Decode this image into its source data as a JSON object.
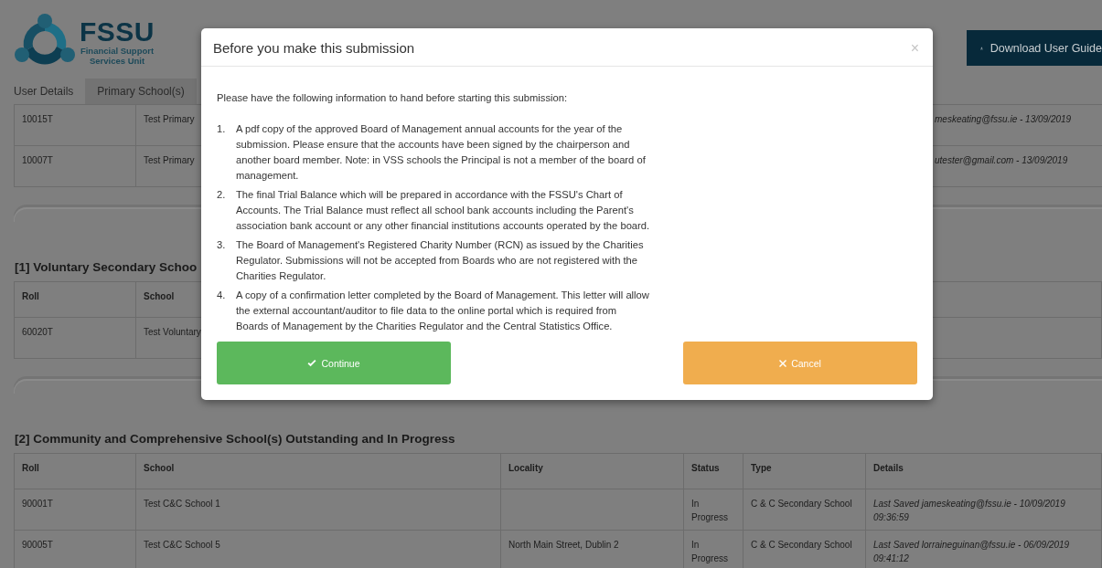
{
  "logo": {
    "name": "FSSU",
    "subtitle_lines": [
      "Financial Support",
      "Services Unit"
    ]
  },
  "download_button": {
    "label": "Download User Guide"
  },
  "tabs": [
    {
      "label": "User Details",
      "selected": false
    },
    {
      "label": "Primary School(s)",
      "selected": true
    }
  ],
  "primary_rows": [
    {
      "roll": "10015T",
      "school": "Test Primary",
      "details": "meskeating@fssu.ie - 13/09/2019"
    },
    {
      "roll": "10007T",
      "school": "Test Primary",
      "details": "utester@gmail.com - 13/09/2019"
    }
  ],
  "sections": [
    {
      "title": "[1] Voluntary Secondary Schoo",
      "columns": [
        "Roll",
        "School"
      ],
      "rows": [
        [
          "60020T",
          "Test Voluntary"
        ]
      ]
    },
    {
      "title": "[2] Community and Comprehensive School(s) Outstanding and In Progress",
      "columns": [
        "Roll",
        "School",
        "Locality",
        "Status",
        "Type",
        "Details"
      ],
      "rows": [
        [
          "90001T",
          "Test C&C School 1",
          "",
          "In Progress",
          "C & C Secondary School",
          "Last Saved jameskeating@fssu.ie - 10/09/2019 09:36:59"
        ],
        [
          "90005T",
          "Test C&C School 5",
          "North Main Street, Dublin 2",
          "In Progress",
          "C & C Secondary School",
          "Last Saved lorraineguinan@fssu.ie - 06/09/2019 09:41:12"
        ]
      ]
    }
  ],
  "modal": {
    "title": "Before you make this submission",
    "close": "×",
    "intro": "Please have the following information to hand before starting this submission:",
    "items": [
      {
        "number": "1.",
        "text": "A pdf copy of the approved Board of Management annual accounts for the year of the submission. Please ensure that the accounts have been signed by the chairperson and another board member. Note: in VSS schools the Principal is not a member of the board of management."
      },
      {
        "number": "2.",
        "text": "The final Trial Balance which will be prepared in accordance with the FSSU's Chart of Accounts. The Trial Balance must reflect all school bank accounts including the Parent's association bank account or any other financial institutions accounts operated by the board."
      },
      {
        "number": "3.",
        "text": "The Board of Management's Registered Charity Number (RCN) as issued by the Charities Regulator. Submissions will not be accepted from Boards who are not registered with the Charities Regulator."
      },
      {
        "number": "4.",
        "text": "A copy of a confirmation letter completed by the Board of Management. This letter will allow the external accountant/auditor to file data to the online portal which is required from Boards of Management by the Charities Regulator and the Central Statistics Office."
      }
    ],
    "buttons": [
      {
        "kind": "confirm",
        "label": "Continue"
      },
      {
        "kind": "cancel",
        "label": "Cancel"
      }
    ]
  }
}
